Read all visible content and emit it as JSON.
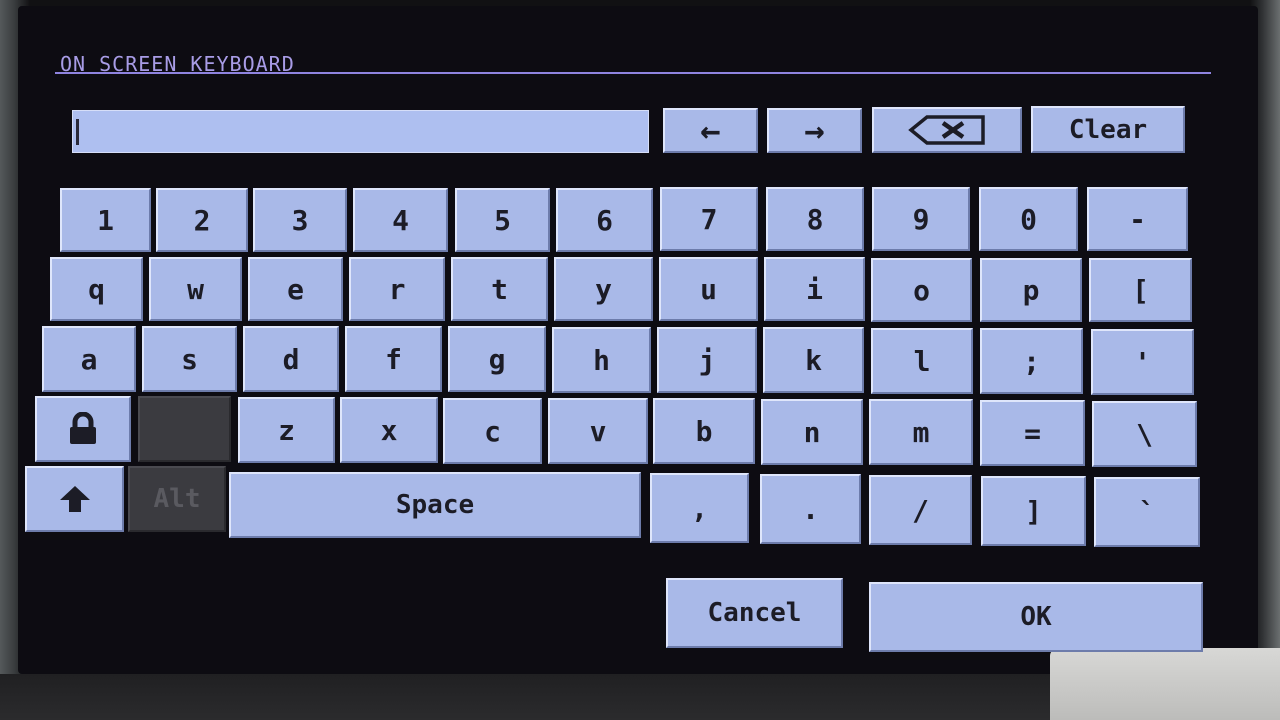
{
  "title": "ON SCREEN KEYBOARD",
  "input": {
    "value": ""
  },
  "toolbar": {
    "left_arrow": "←",
    "right_arrow": "→",
    "backspace_icon": "backspace-icon",
    "clear_label": "Clear"
  },
  "rows": {
    "r1": [
      "1",
      "2",
      "3",
      "4",
      "5",
      "6",
      "7",
      "8",
      "9",
      "0",
      "-"
    ],
    "r2": [
      "q",
      "w",
      "e",
      "r",
      "t",
      "y",
      "u",
      "i",
      "o",
      "p",
      "["
    ],
    "r3": [
      "a",
      "s",
      "d",
      "f",
      "g",
      "h",
      "j",
      "k",
      "l",
      ";",
      "'"
    ],
    "r4": [
      "z",
      "x",
      "c",
      "v",
      "b",
      "n",
      "m",
      "=",
      "\\"
    ],
    "r5": [
      ",",
      ".",
      "/",
      "]",
      "`"
    ]
  },
  "special": {
    "lock_icon": "lock-icon",
    "shift_icon": "shift-arrow-icon",
    "alt_label": "Alt",
    "space_label": "Space"
  },
  "actions": {
    "cancel_label": "Cancel",
    "ok_label": "OK"
  },
  "colors": {
    "key_face": "#a9b9e8",
    "title_accent": "#a89ce6",
    "screen_bg": "#0d0c12"
  }
}
